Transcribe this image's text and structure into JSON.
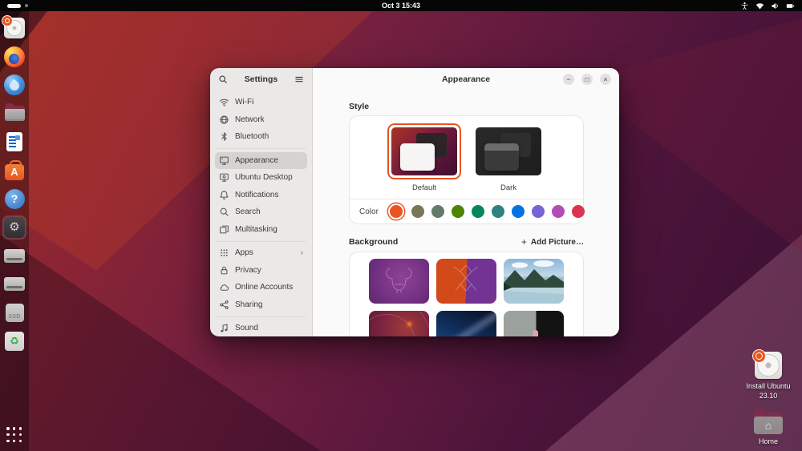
{
  "topbar": {
    "clock": "Oct 3 15:43"
  },
  "dock": {
    "items": [
      {
        "name": "install-ubuntu-installer"
      },
      {
        "name": "firefox"
      },
      {
        "name": "thunderbird"
      },
      {
        "name": "files"
      },
      {
        "name": "libreoffice-writer"
      },
      {
        "name": "app-center",
        "glyph": "A"
      },
      {
        "name": "help",
        "glyph": "?"
      },
      {
        "name": "settings",
        "glyph": "⚙",
        "active": true
      },
      {
        "name": "drive-1"
      },
      {
        "name": "drive-2"
      },
      {
        "name": "drive-ssd",
        "label": "SSD"
      },
      {
        "name": "trash",
        "glyph": "♻"
      }
    ]
  },
  "window": {
    "sidebar": {
      "title": "Settings",
      "items": [
        {
          "label": "Wi-Fi"
        },
        {
          "label": "Network"
        },
        {
          "label": "Bluetooth"
        },
        {
          "label": "Appearance",
          "selected": true
        },
        {
          "label": "Ubuntu Desktop"
        },
        {
          "label": "Notifications"
        },
        {
          "label": "Search"
        },
        {
          "label": "Multitasking"
        },
        {
          "label": "Apps",
          "chevron": "›"
        },
        {
          "label": "Privacy"
        },
        {
          "label": "Online Accounts"
        },
        {
          "label": "Sharing"
        },
        {
          "label": "Sound"
        }
      ]
    },
    "header": {
      "title": "Appearance",
      "minimize_glyph": "−",
      "maximize_glyph": "□",
      "close_glyph": "×"
    },
    "style_section": {
      "title": "Style",
      "options": [
        {
          "label": "Default",
          "selected": true
        },
        {
          "label": "Dark",
          "selected": false
        }
      ],
      "color_label": "Color",
      "colors": [
        {
          "name": "orange",
          "hex": "#E95420",
          "selected": true
        },
        {
          "name": "bark",
          "hex": "#787859"
        },
        {
          "name": "sage",
          "hex": "#657B69"
        },
        {
          "name": "olive",
          "hex": "#4B8501"
        },
        {
          "name": "viridian",
          "hex": "#03875B"
        },
        {
          "name": "prussian-green",
          "hex": "#308280"
        },
        {
          "name": "blue",
          "hex": "#0073E5"
        },
        {
          "name": "purple",
          "hex": "#7764D8"
        },
        {
          "name": "magenta",
          "hex": "#B34CB3"
        },
        {
          "name": "red",
          "hex": "#DA3450"
        }
      ]
    },
    "background_section": {
      "title": "Background",
      "add_picture": {
        "icon": "+",
        "label": "Add Picture…"
      },
      "wallpapers": [
        {
          "name": "mantic-minotaur-purple"
        },
        {
          "name": "mantic-minotaur-orange-purple"
        },
        {
          "name": "mountain-lake"
        },
        {
          "name": "ubuntu-circles-maroon"
        },
        {
          "name": "milky-way"
        },
        {
          "name": "numbat-figure"
        }
      ]
    }
  },
  "desktop_icons": [
    {
      "label": "Install Ubuntu\n23.10"
    },
    {
      "label": "Home"
    }
  ],
  "accent": "#E95420"
}
